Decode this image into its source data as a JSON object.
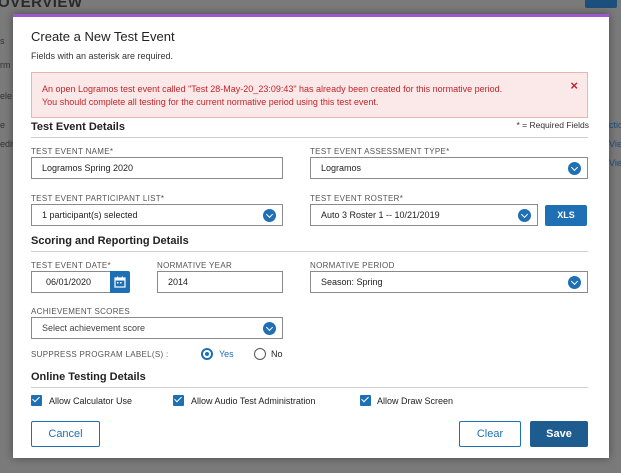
{
  "background": {
    "title": "OVERVIEW",
    "left_fragments": [
      "s",
      "rm",
      "ele",
      "e",
      "edit"
    ],
    "right_fragments": [
      "ctio",
      "Vie",
      "Vie"
    ]
  },
  "modal": {
    "title": "Create a New Test Event",
    "subtitle": "Fields with an asterisk are required.",
    "alert": {
      "line1": "An open Logramos test event called \"Test 28-May-20_23:09:43\" has already been created for this normative period.",
      "line2": "You should complete all testing for the current normative period using this test event.",
      "close": "×"
    },
    "sections": {
      "details": "Test Event Details",
      "scoring": "Scoring and Reporting Details",
      "online": "Online Testing Details"
    },
    "required_note": "* = Required Fields",
    "fields": {
      "name": {
        "label": "TEST EVENT NAME*",
        "value": "Logramos Spring 2020"
      },
      "assessment_type": {
        "label": "TEST EVENT ASSESSMENT TYPE*",
        "value": "Logramos"
      },
      "participant_list": {
        "label": "TEST EVENT PARTICIPANT LIST*",
        "value": "1 participant(s) selected"
      },
      "roster": {
        "label": "TEST EVENT ROSTER*",
        "value": "Auto 3 Roster 1 -- 10/21/2019"
      },
      "date": {
        "label": "TEST EVENT DATE*",
        "value": "06/01/2020"
      },
      "normative_year": {
        "label": "NORMATIVE YEAR",
        "value": "2014"
      },
      "normative_period": {
        "label": "NORMATIVE PERIOD",
        "value": "Season: Spring"
      },
      "achievement": {
        "label": "ACHIEVEMENT SCORES",
        "value": "Select achievement score"
      }
    },
    "xls_label": "XLS",
    "suppress": {
      "label": "SUPPRESS PROGRAM LABEL(S) :",
      "yes": "Yes",
      "no": "No"
    },
    "checkboxes": {
      "calculator": "Allow Calculator Use",
      "audio": "Allow Audio Test Administration",
      "draw": "Allow Draw Screen"
    },
    "buttons": {
      "cancel": "Cancel",
      "clear": "Clear",
      "save": "Save"
    }
  },
  "colors": {
    "primary": "#1f6fb5",
    "alert_text": "#c0252a",
    "accent_top": "#9b59d0"
  }
}
